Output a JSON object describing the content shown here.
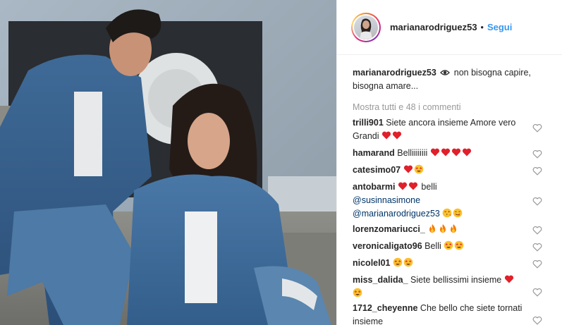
{
  "post": {
    "username": "marianarodriguez53",
    "follow_label": "Segui",
    "separator": "•"
  },
  "caption": {
    "username": "marianarodriguez53",
    "text": "non bisogna capire, bisogna amare..."
  },
  "show_all_comments": "Mostra tutti e 48 i commenti",
  "comments": [
    {
      "username": "trilli901",
      "text": "Siete ancora insieme Amore vero Grandi",
      "emoji": [
        "heart",
        "heart"
      ]
    },
    {
      "username": "hamarand",
      "text": "Belliiiiiiii",
      "emoji": [
        "heart",
        "heart",
        "heart",
        "heart"
      ]
    },
    {
      "username": "catesimo07",
      "text": "",
      "emoji": [
        "heart",
        "star-eyes"
      ]
    },
    {
      "username": "antobarmi",
      "text": "belli",
      "emoji_before_text": [
        "heart",
        "heart"
      ],
      "mentions": [
        "@susinnasimone",
        "@marianarodriguez53"
      ],
      "emoji": [
        "wink-kiss",
        "yum"
      ]
    },
    {
      "username": "lorenzomariucci_",
      "text": "",
      "emoji": [
        "fire",
        "fire",
        "fire"
      ]
    },
    {
      "username": "veronicaligato96",
      "text": "Belli",
      "emoji": [
        "star-eyes",
        "star-eyes"
      ]
    },
    {
      "username": "nicolel01",
      "text": "",
      "emoji": [
        "star-eyes",
        "star-eyes"
      ]
    },
    {
      "username": "miss_dalida_",
      "text": "Siete bellissimi insieme",
      "emoji": [
        "heart",
        "star-eyes"
      ]
    },
    {
      "username": "1712_cheyenne",
      "text": "Che bello che siete tornati insieme",
      "emoji": []
    }
  ],
  "colors": {
    "link": "#3897f0",
    "muted": "#999999",
    "mention": "#003569",
    "heart_red": "#e0202a"
  },
  "icons": {
    "like": "heart-outline-icon",
    "caption_emoji": "eye-icon"
  }
}
